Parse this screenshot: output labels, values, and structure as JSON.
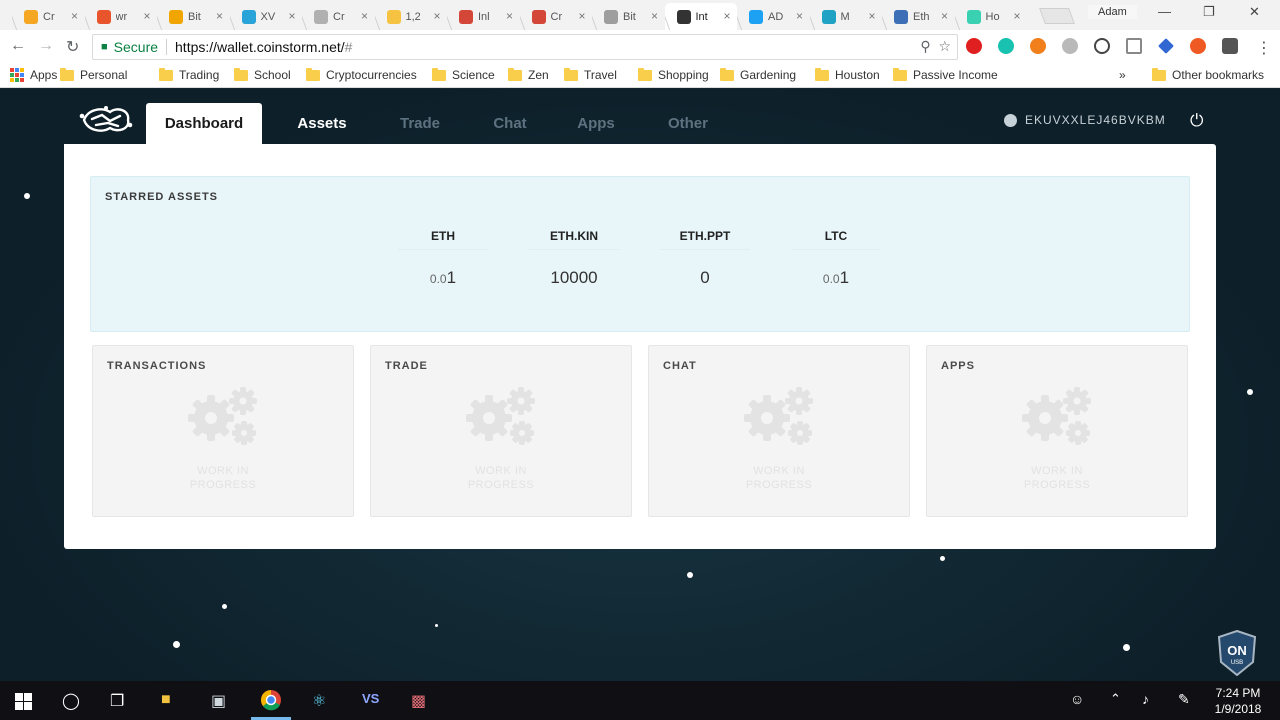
{
  "browser": {
    "tabs": [
      {
        "label": "Cr",
        "fav_color": "#f5a623"
      },
      {
        "label": "wr",
        "fav_color": "#e8542c"
      },
      {
        "label": "Bit",
        "fav_color": "#f0a500"
      },
      {
        "label": "XV",
        "fav_color": "#2aa3d8"
      },
      {
        "label": "Cr",
        "fav_color": "#b0b0b0"
      },
      {
        "label": "1,2",
        "fav_color": "#f5c242"
      },
      {
        "label": "Inl",
        "fav_color": "#d44638"
      },
      {
        "label": "Cr",
        "fav_color": "#d44638"
      },
      {
        "label": "Bit",
        "fav_color": "#9e9e9e"
      },
      {
        "label": "Int",
        "fav_color": "#333333"
      },
      {
        "label": "AD",
        "fav_color": "#1da1f2"
      },
      {
        "label": "M",
        "fav_color": "#1fa2c4"
      },
      {
        "label": "Eth",
        "fav_color": "#3c6fb6"
      },
      {
        "label": "Ho",
        "fav_color": "#3ad1b2"
      }
    ],
    "active_tab_index": 9,
    "profile_name": "Adam",
    "secure_label": "Secure",
    "url_host": "https://wallet.coinstorm.net/",
    "url_path": "#",
    "bookmarks": {
      "apps_label": "Apps",
      "items": [
        "Personal",
        "Trading",
        "School",
        "Cryptocurrencies",
        "Science",
        "Zen",
        "Travel",
        "Shopping",
        "Gardening",
        "Houston",
        "Passive Income"
      ],
      "overflow": "»",
      "other": "Other bookmarks"
    }
  },
  "app": {
    "nav": [
      {
        "label": "Dashboard",
        "state": "active"
      },
      {
        "label": "Assets",
        "state": "enabled"
      },
      {
        "label": "Trade",
        "state": "disabled"
      },
      {
        "label": "Chat",
        "state": "disabled"
      },
      {
        "label": "Apps",
        "state": "disabled"
      },
      {
        "label": "Other",
        "state": "disabled"
      }
    ],
    "account_id": "EKUVXXLEJ46BVKBM",
    "starred": {
      "title": "STARRED ASSETS",
      "assets": [
        {
          "name": "ETH",
          "value_small": "0.0",
          "value_main": "1"
        },
        {
          "name": "ETH.KIN",
          "value_small": "",
          "value_main": "10000"
        },
        {
          "name": "ETH.PPT",
          "value_small": "",
          "value_main": "0"
        },
        {
          "name": "LTC",
          "value_small": "0.0",
          "value_main": "1"
        }
      ]
    },
    "cards": [
      {
        "title": "TRANSACTIONS",
        "wip": "WORK IN PROGRESS"
      },
      {
        "title": "TRADE",
        "wip": "WORK IN PROGRESS"
      },
      {
        "title": "CHAT",
        "wip": "WORK IN PROGRESS"
      },
      {
        "title": "APPS",
        "wip": "WORK IN PROGRESS"
      }
    ],
    "badge_label": "ON",
    "badge_sub": "USB"
  },
  "taskbar": {
    "time": "7:24 PM",
    "date": "1/9/2018"
  },
  "colors": {
    "page_bg": "#0f2530",
    "starred_bg": "#e8f6fa",
    "card_bg": "#f4f4f4",
    "nav_disabled": "#5d7280",
    "secure_green": "#0b8043"
  }
}
